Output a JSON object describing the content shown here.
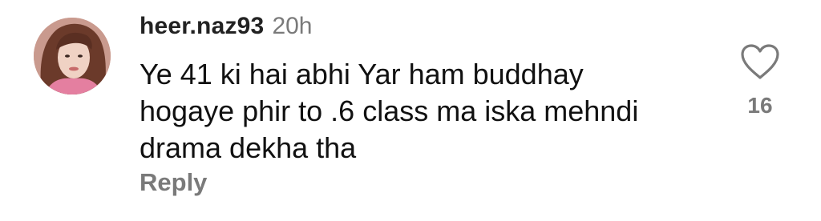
{
  "comment": {
    "username": "heer.naz93",
    "time": "20h",
    "text_lines": [
      "Ye 41 ki hai abhi Yar ham buddhay",
      "hogaye phir to .6 class ma iska mehndi",
      "drama dekha tha"
    ],
    "reply_label": "Reply",
    "like_count": "16",
    "like_icon": "heart-outline-icon"
  },
  "colors": {
    "username": "#222222",
    "muted": "#7a7a7a",
    "text": "#111111",
    "background": "#ffffff"
  }
}
